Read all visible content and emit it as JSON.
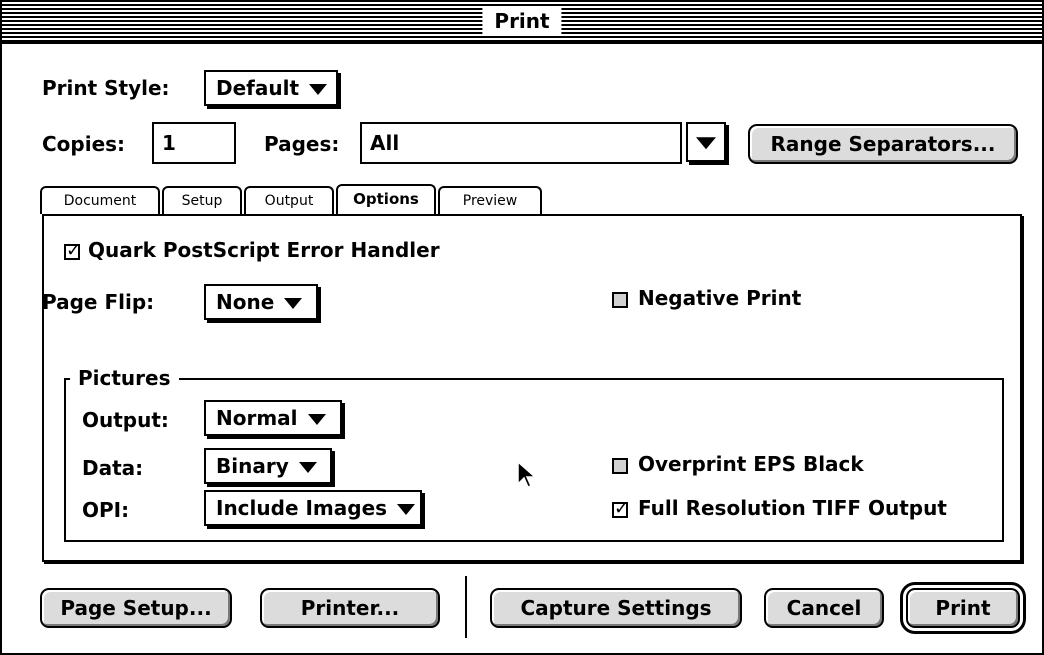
{
  "window": {
    "title": "Print"
  },
  "print_style": {
    "label": "Print Style:",
    "value": "Default"
  },
  "copies": {
    "label": "Copies:",
    "value": "1"
  },
  "pages": {
    "label": "Pages:",
    "value": "All"
  },
  "range_separators": {
    "label": "Range Separators..."
  },
  "tabs": [
    {
      "label": "Document",
      "active": false
    },
    {
      "label": "Setup",
      "active": false
    },
    {
      "label": "Output",
      "active": false
    },
    {
      "label": "Options",
      "active": true
    },
    {
      "label": "Preview",
      "active": false
    }
  ],
  "options": {
    "error_handler": {
      "label": "Quark PostScript Error Handler",
      "checked": true
    },
    "page_flip": {
      "label": "Page Flip:",
      "value": "None"
    },
    "negative_print": {
      "label": "Negative Print",
      "checked": false
    },
    "pictures": {
      "legend": "Pictures",
      "output": {
        "label": "Output:",
        "value": "Normal"
      },
      "data": {
        "label": "Data:",
        "value": "Binary"
      },
      "opi": {
        "label": "OPI:",
        "value": "Include Images"
      },
      "overprint_eps_black": {
        "label": "Overprint EPS Black",
        "checked": false
      },
      "full_res_tiff": {
        "label": "Full Resolution TIFF Output",
        "checked": true
      }
    }
  },
  "buttons": {
    "page_setup": "Page Setup...",
    "printer": "Printer...",
    "capture_settings": "Capture Settings",
    "cancel": "Cancel",
    "print": "Print"
  }
}
